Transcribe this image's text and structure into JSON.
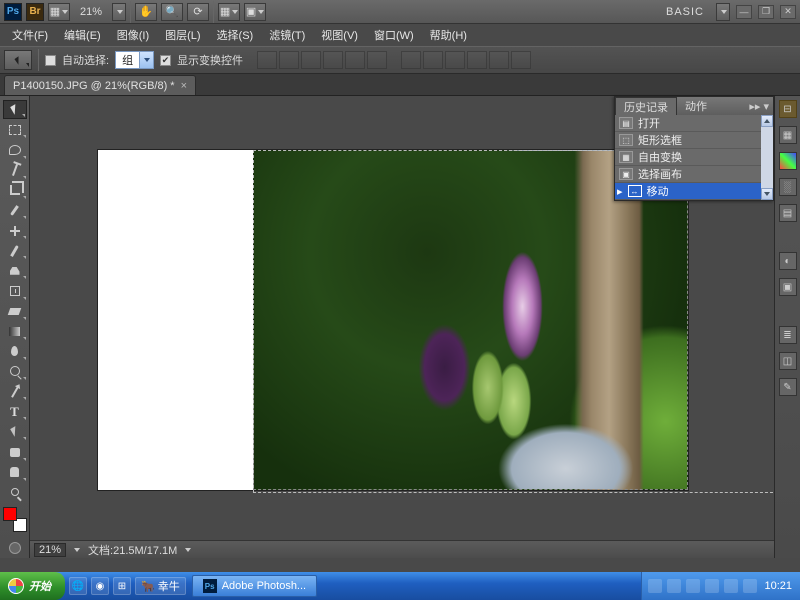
{
  "top": {
    "zoom_dropdown": "21%",
    "workspace": "BASIC"
  },
  "menu": {
    "file": "文件(F)",
    "edit": "编辑(E)",
    "image": "图像(I)",
    "layer": "图层(L)",
    "select": "选择(S)",
    "filter": "滤镜(T)",
    "view": "视图(V)",
    "window": "窗口(W)",
    "help": "帮助(H)"
  },
  "options": {
    "auto_select": "自动选择:",
    "group_value": "组",
    "show_controls": "显示变换控件"
  },
  "doc": {
    "tab_title": "P1400150.JPG @ 21%(RGB/8) *"
  },
  "history": {
    "tab_history": "历史记录",
    "tab_actions": "动作",
    "items": [
      "打开",
      "矩形选框",
      "自由变换",
      "选择画布",
      "移动"
    ],
    "selected_index": 4
  },
  "status": {
    "zoom": "21%",
    "doc_size": "文档:21.5M/17.1M"
  },
  "taskbar": {
    "start": "开始",
    "ql_label": "幸牛",
    "app": "Adobe Photosh...",
    "clock": "10:21"
  }
}
